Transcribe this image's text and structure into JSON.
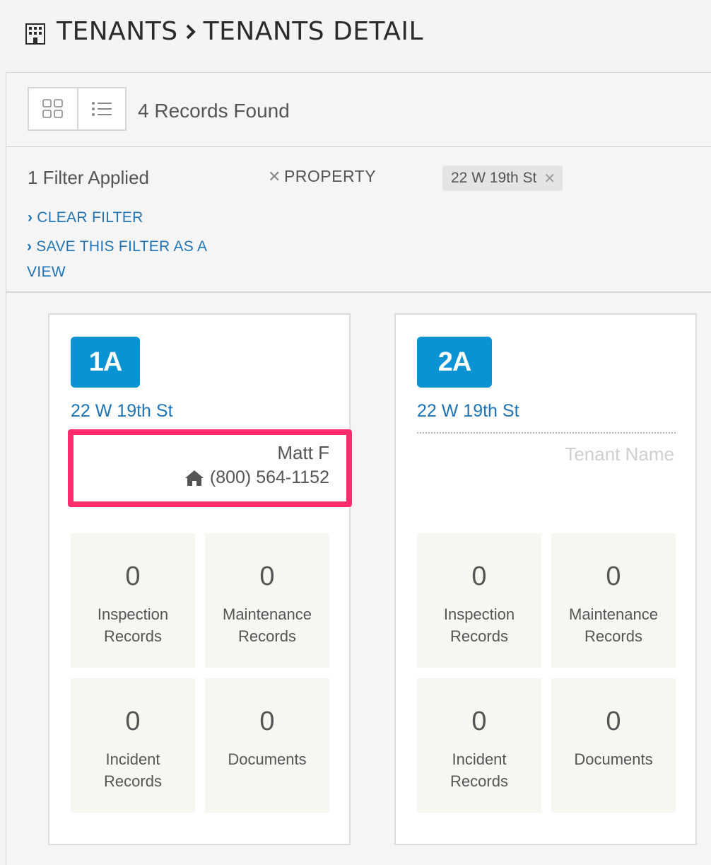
{
  "header": {
    "crumb1": "TENANTS",
    "crumb2": "TENANTS DETAIL"
  },
  "toolbar": {
    "records_found": "4 Records Found"
  },
  "filters": {
    "applied": "1 Filter Applied",
    "property_label": "PROPERTY",
    "chip_value": "22 W 19th St",
    "clear_filter": "CLEAR FILTER",
    "save_line1": "SAVE THIS FILTER AS A",
    "save_line2": "VIEW"
  },
  "cards": [
    {
      "unit": "1A",
      "address": "22 W 19th St",
      "tenant_name": "Matt F",
      "tenant_phone": "(800) 564-1152",
      "stats": [
        {
          "value": "0",
          "label": "Inspection Records"
        },
        {
          "value": "0",
          "label": "Maintenance Records"
        },
        {
          "value": "0",
          "label": "Incident Records"
        },
        {
          "value": "0",
          "label": "Documents"
        }
      ]
    },
    {
      "unit": "2A",
      "address": "22 W 19th St",
      "tenant_placeholder": "Tenant Name",
      "stats": [
        {
          "value": "0",
          "label": "Inspection Records"
        },
        {
          "value": "0",
          "label": "Maintenance Records"
        },
        {
          "value": "0",
          "label": "Incident Records"
        },
        {
          "value": "0",
          "label": "Documents"
        }
      ]
    }
  ],
  "colors": {
    "accent_blue": "#0a93d4",
    "link_blue": "#1f74b7",
    "highlight": "#ff2d6e"
  }
}
